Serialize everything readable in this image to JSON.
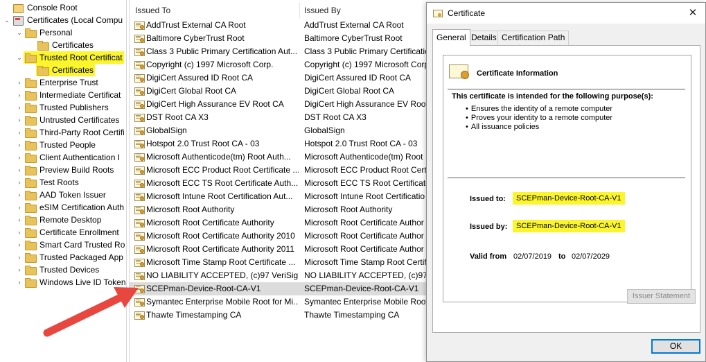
{
  "tree": {
    "items": [
      {
        "label": "Console Root",
        "level": 0,
        "expander": "",
        "icon": "console-root-icon",
        "highlight": false
      },
      {
        "label": "Certificates (Local Compu",
        "level": 1,
        "expander": "⌄",
        "icon": "certificate-store-icon",
        "highlight": false
      },
      {
        "label": "Personal",
        "level": 2,
        "expander": "⌄",
        "icon": "folder-icon",
        "highlight": false
      },
      {
        "label": "Certificates",
        "level": 3,
        "expander": "",
        "icon": "folder-icon",
        "highlight": false
      },
      {
        "label": "Trusted Root Certificat",
        "level": 2,
        "expander": "⌄",
        "icon": "folder-icon",
        "highlight": true
      },
      {
        "label": "Certificates",
        "level": 3,
        "expander": "",
        "icon": "folder-icon",
        "highlight": true
      },
      {
        "label": "Enterprise Trust",
        "level": 2,
        "expander": "›",
        "icon": "folder-icon",
        "highlight": false
      },
      {
        "label": "Intermediate Certificat",
        "level": 2,
        "expander": "›",
        "icon": "folder-icon",
        "highlight": false
      },
      {
        "label": "Trusted Publishers",
        "level": 2,
        "expander": "›",
        "icon": "folder-icon",
        "highlight": false
      },
      {
        "label": "Untrusted Certificates",
        "level": 2,
        "expander": "›",
        "icon": "folder-icon",
        "highlight": false
      },
      {
        "label": "Third-Party Root Certifi",
        "level": 2,
        "expander": "›",
        "icon": "folder-icon",
        "highlight": false
      },
      {
        "label": "Trusted People",
        "level": 2,
        "expander": "›",
        "icon": "folder-icon",
        "highlight": false
      },
      {
        "label": "Client Authentication I",
        "level": 2,
        "expander": "›",
        "icon": "folder-icon",
        "highlight": false
      },
      {
        "label": "Preview Build Roots",
        "level": 2,
        "expander": "›",
        "icon": "folder-icon",
        "highlight": false
      },
      {
        "label": "Test Roots",
        "level": 2,
        "expander": "›",
        "icon": "folder-icon",
        "highlight": false
      },
      {
        "label": "AAD Token Issuer",
        "level": 2,
        "expander": "›",
        "icon": "folder-icon",
        "highlight": false
      },
      {
        "label": "eSIM Certification Auth",
        "level": 2,
        "expander": "›",
        "icon": "folder-icon",
        "highlight": false
      },
      {
        "label": "Remote Desktop",
        "level": 2,
        "expander": "›",
        "icon": "folder-icon",
        "highlight": false
      },
      {
        "label": "Certificate Enrollment",
        "level": 2,
        "expander": "›",
        "icon": "folder-icon",
        "highlight": false
      },
      {
        "label": "Smart Card Trusted Ro",
        "level": 2,
        "expander": "›",
        "icon": "folder-icon",
        "highlight": false
      },
      {
        "label": "Trusted Packaged App",
        "level": 2,
        "expander": "›",
        "icon": "folder-icon",
        "highlight": false
      },
      {
        "label": "Trusted Devices",
        "level": 2,
        "expander": "›",
        "icon": "folder-icon",
        "highlight": false
      },
      {
        "label": "Windows Live ID Token",
        "level": 2,
        "expander": "›",
        "icon": "folder-icon",
        "highlight": false
      }
    ]
  },
  "list": {
    "columns": [
      "Issued To",
      "Issued By"
    ],
    "rows": [
      {
        "issued_to": "AddTrust External CA Root",
        "issued_by": "AddTrust External CA Root",
        "selected": false
      },
      {
        "issued_to": "Baltimore CyberTrust Root",
        "issued_by": "Baltimore CyberTrust Root",
        "selected": false
      },
      {
        "issued_to": "Class 3 Public Primary Certification Aut...",
        "issued_by": "Class 3 Public Primary Certification",
        "selected": false
      },
      {
        "issued_to": "Copyright (c) 1997 Microsoft Corp.",
        "issued_by": "Copyright (c) 1997 Microsoft Corp",
        "selected": false
      },
      {
        "issued_to": "DigiCert Assured ID Root CA",
        "issued_by": "DigiCert Assured ID Root CA",
        "selected": false
      },
      {
        "issued_to": "DigiCert Global Root CA",
        "issued_by": "DigiCert Global Root CA",
        "selected": false
      },
      {
        "issued_to": "DigiCert High Assurance EV Root CA",
        "issued_by": "DigiCert High Assurance EV Root",
        "selected": false
      },
      {
        "issued_to": "DST Root CA X3",
        "issued_by": "DST Root CA X3",
        "selected": false
      },
      {
        "issued_to": "GlobalSign",
        "issued_by": "GlobalSign",
        "selected": false
      },
      {
        "issued_to": "Hotspot 2.0 Trust Root CA - 03",
        "issued_by": "Hotspot 2.0 Trust Root CA - 03",
        "selected": false
      },
      {
        "issued_to": "Microsoft Authenticode(tm) Root Auth...",
        "issued_by": "Microsoft Authenticode(tm) Root",
        "selected": false
      },
      {
        "issued_to": "Microsoft ECC Product Root Certificate ...",
        "issued_by": "Microsoft ECC Product Root Certi",
        "selected": false
      },
      {
        "issued_to": "Microsoft ECC TS Root Certificate Auth...",
        "issued_by": "Microsoft ECC TS Root Certificate",
        "selected": false
      },
      {
        "issued_to": "Microsoft Intune Root Certification Aut...",
        "issued_by": "Microsoft Intune Root Certificatio",
        "selected": false
      },
      {
        "issued_to": "Microsoft Root Authority",
        "issued_by": "Microsoft Root Authority",
        "selected": false
      },
      {
        "issued_to": "Microsoft Root Certificate Authority",
        "issued_by": "Microsoft Root Certificate Author",
        "selected": false
      },
      {
        "issued_to": "Microsoft Root Certificate Authority 2010",
        "issued_by": "Microsoft Root Certificate Author",
        "selected": false
      },
      {
        "issued_to": "Microsoft Root Certificate Authority 2011",
        "issued_by": "Microsoft Root Certificate Author",
        "selected": false
      },
      {
        "issued_to": "Microsoft Time Stamp Root Certificate ...",
        "issued_by": "Microsoft Time Stamp Root Certif",
        "selected": false
      },
      {
        "issued_to": "NO LIABILITY ACCEPTED, (c)97 VeriSign,...",
        "issued_by": "NO LIABILITY ACCEPTED, (c)97 Ve",
        "selected": false
      },
      {
        "issued_to": "SCEPman-Device-Root-CA-V1",
        "issued_by": "SCEPman-Device-Root-CA-V1",
        "selected": true
      },
      {
        "issued_to": "Symantec Enterprise Mobile Root for Mi...",
        "issued_by": "Symantec Enterprise Mobile Root",
        "selected": false
      },
      {
        "issued_to": "Thawte Timestamping CA",
        "issued_by": "Thawte Timestamping CA",
        "selected": false
      }
    ]
  },
  "annotation": {
    "arrow_color": "#e8473f",
    "highlight_color": "#fbf52d"
  },
  "dialog": {
    "title": "Certificate",
    "close_glyph": "✕",
    "tabs": [
      "General",
      "Details",
      "Certification Path"
    ],
    "active_tab": "General",
    "info_title": "Certificate Information",
    "purpose_heading": "This certificate is intended for the following purpose(s):",
    "purposes": [
      "Ensures the identity of a remote computer",
      "Proves your identity to a remote computer",
      "All issuance policies"
    ],
    "issued_to_label": "Issued to:",
    "issued_to_value": "SCEPman-Device-Root-CA-V1",
    "issued_by_label": "Issued by:",
    "issued_by_value": "SCEPman-Device-Root-CA-V1",
    "valid_from_label": "Valid from",
    "valid_from": "02/07/2019",
    "valid_to_label": "to",
    "valid_to": "02/07/2029",
    "issuer_statement_label": "Issuer Statement",
    "ok_label": "OK"
  }
}
